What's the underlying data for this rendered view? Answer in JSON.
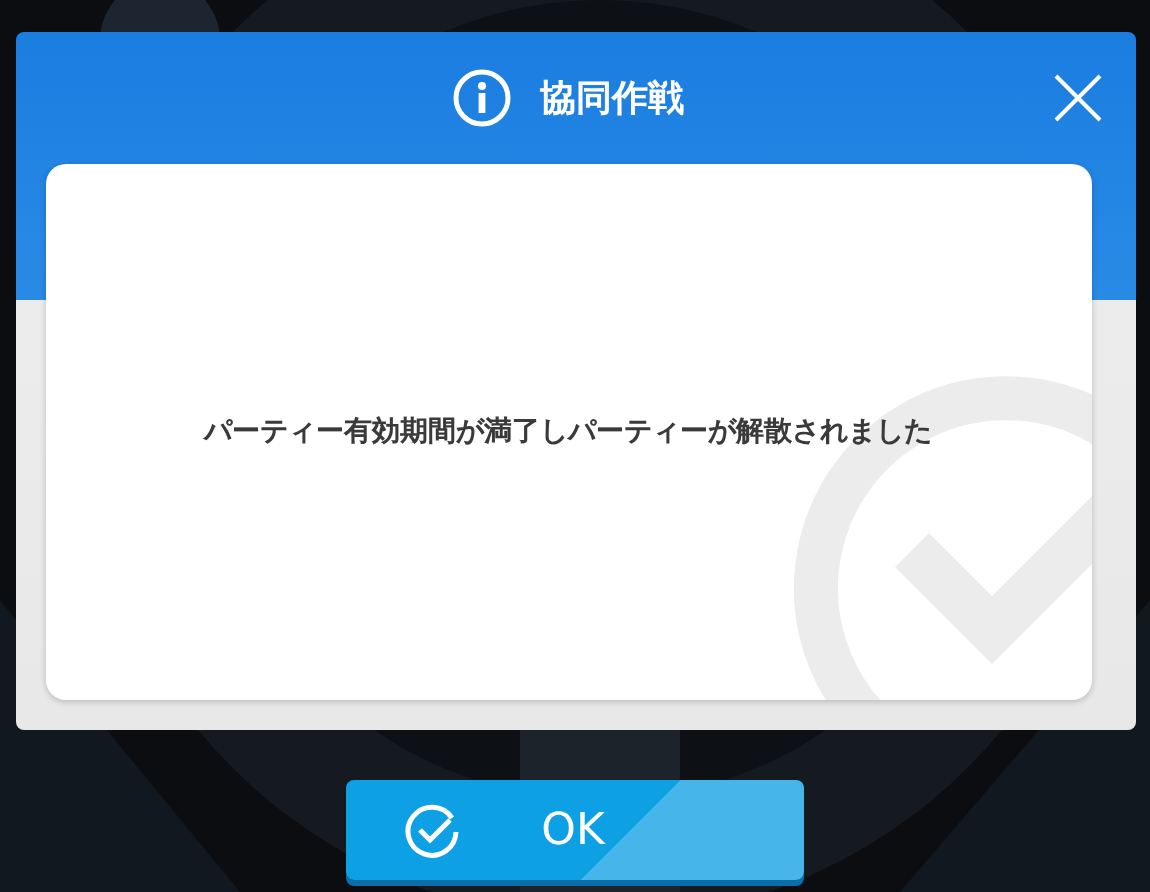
{
  "dialog": {
    "title": "協同作戦",
    "message": "パーティー有効期間が満了しパーティーが解散されました"
  },
  "button": {
    "label": "OK"
  }
}
